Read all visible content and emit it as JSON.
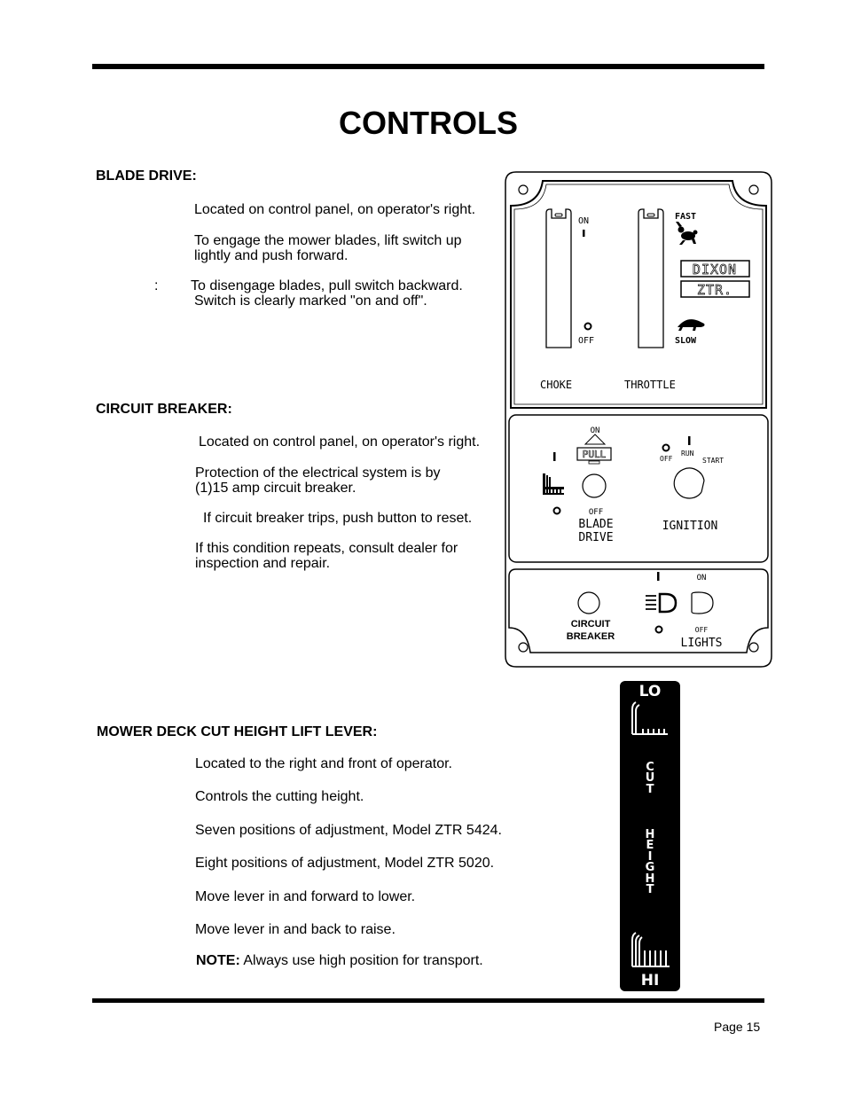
{
  "page": {
    "title": "CONTROLS",
    "page_number": "Page 15"
  },
  "sections": {
    "blade_drive": {
      "heading": "BLADE DRIVE:",
      "paragraphs": [
        "Located on control panel, on operator's right.",
        "To engage the mower blades, lift switch up",
        "lightly and push forward.",
        "To disengage blades, pull switch backward.",
        "Switch is clearly marked \"on and off\"."
      ],
      "colon_marker": ":"
    },
    "circuit_breaker": {
      "heading": "CIRCUIT BREAKER:",
      "paragraphs": [
        "Located on control panel, on operator's right.",
        "Protection of the electrical system is by",
        "(1)15 amp circuit breaker.",
        "If circuit breaker trips, push button to reset.",
        "If this condition repeats, consult dealer for",
        "inspection and repair."
      ]
    },
    "cut_height": {
      "heading": "MOWER DECK CUT HEIGHT LIFT LEVER:",
      "paragraphs": [
        "Located to the right and front of operator.",
        "Controls the cutting height.",
        "Seven positions of adjustment, Model ZTR 5424.",
        "Eight positions of adjustment, Model ZTR 5020.",
        "Move lever in and forward to lower.",
        "Move lever in and back to raise."
      ],
      "note_label": "NOTE:",
      "note_text": " Always use high position for transport."
    }
  },
  "panel": {
    "choke": {
      "on": "ON",
      "off": "OFF",
      "label": "CHOKE"
    },
    "throttle": {
      "fast": "FAST",
      "slow": "SLOW",
      "label": "THROTTLE",
      "fast_icon": "rabbit-icon",
      "slow_icon": "turtle-icon"
    },
    "brand": {
      "line1": "DIXON",
      "line2": "ZTR."
    },
    "blade_drive": {
      "on": "ON",
      "pull": "PULL",
      "off": "OFF",
      "label_line1": "BLADE",
      "label_line2": "DRIVE"
    },
    "ignition": {
      "off": "OFF",
      "run": "RUN",
      "start": "START",
      "label": "IGNITION"
    },
    "circuit_breaker": {
      "label_line1": "CIRCUIT",
      "label_line2": "BREAKER"
    },
    "lights": {
      "on": "ON",
      "off": "OFF",
      "label": "LIGHTS"
    }
  },
  "cut_height_decal": {
    "top": "LO",
    "vertical1": [
      "C",
      "U",
      "T"
    ],
    "vertical2": [
      "H",
      "E",
      "I",
      "G",
      "H",
      "T"
    ],
    "bottom": "HI"
  }
}
